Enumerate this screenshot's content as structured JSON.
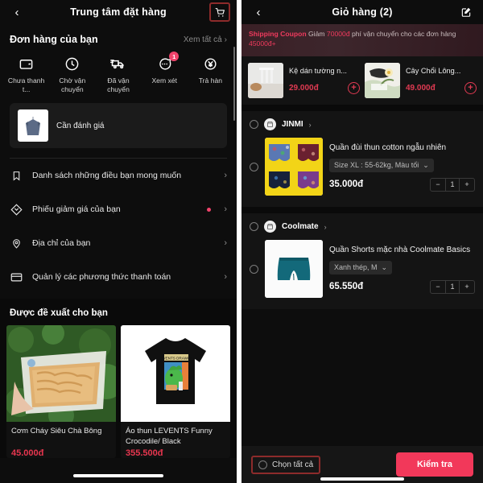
{
  "left_panel": {
    "header": {
      "back_icon": "chevron-left-icon",
      "title": "Trung tâm đặt hàng",
      "cart_icon": "cart-icon"
    },
    "orders_section": {
      "title": "Đơn hàng của bạn",
      "see_all": "Xem tất cả",
      "see_all_chevron": "›"
    },
    "status_items": [
      {
        "icon": "wallet-icon",
        "label": "Chưa thanh t...",
        "badge": ""
      },
      {
        "icon": "clock-icon",
        "label": "Chờ vận chuyển",
        "badge": ""
      },
      {
        "icon": "truck-icon",
        "label": "Đã vận chuyển",
        "badge": ""
      },
      {
        "icon": "chat-icon",
        "label": "Xem xét",
        "badge": "1"
      },
      {
        "icon": "refund-yen-icon",
        "label": "Trả hàn",
        "badge": ""
      }
    ],
    "review_card": {
      "thumb_icon": "shirt-hanger-image",
      "label": "Cần đánh giá"
    },
    "menu_items": [
      {
        "icon": "bookmark-icon",
        "label": "Danh sách những điều bạn mong muốn",
        "dot": false,
        "chevron": "›"
      },
      {
        "icon": "coupon-icon",
        "label": "Phiếu giảm giá của bạn",
        "dot": true,
        "chevron": "›"
      },
      {
        "icon": "location-pin-icon",
        "label": "Địa chỉ của bạn",
        "dot": false,
        "chevron": "›"
      },
      {
        "icon": "credit-card-icon",
        "label": "Quản lý các phương thức thanh toán",
        "dot": false,
        "chevron": "›"
      }
    ],
    "recommend": {
      "title": "Được đề xuất cho bạn",
      "products": [
        {
          "name": "Cơm Cháy Siêu Chà Bông",
          "price": "45.000đ",
          "image": "rice-crisp-snack-photo"
        },
        {
          "name": "Áo thun LEVENTS Funny Crocodile/ Black",
          "price": "355.500đ",
          "image": "black-tshirt-photo"
        }
      ]
    }
  },
  "right_panel": {
    "header": {
      "back_icon": "chevron-left-icon",
      "title": "Giỏ hàng (2)",
      "edit_icon": "edit-square-icon"
    },
    "coupon": {
      "tag": "Shipping Coupon",
      "text_before": "Giảm ",
      "amount1": "70000đ",
      "text_mid": " phí vận chuyển cho các đơn hàng ",
      "amount2": "45000đ+"
    },
    "promos": [
      {
        "name": "Kệ dán tường n...",
        "price": "29.000đ",
        "add_icon": "plus-circle-icon",
        "image": "wall-shelf-photo"
      },
      {
        "name": "Cây Chổi Lông...",
        "price": "49.000đ",
        "add_icon": "plus-circle-icon",
        "image": "feather-duster-photo"
      }
    ],
    "shops": [
      {
        "select_icon": "radio-unchecked-icon",
        "shop_icon": "store-icon",
        "name": "JINMI",
        "chevron": "›",
        "item": {
          "select_icon": "radio-unchecked-icon",
          "name": "Quần đùi thun cotton ngẫu nhiên",
          "variant": "Size XL : 55-62kg, Màu tối",
          "variant_chevron": "⌄",
          "price": "35.000đ",
          "qty": "1",
          "minus": "−",
          "plus": "+",
          "image": "boxer-shorts-grid-photo"
        }
      },
      {
        "select_icon": "radio-unchecked-icon",
        "shop_icon": "store-icon",
        "name": "Coolmate",
        "chevron": "›",
        "item": {
          "select_icon": "radio-unchecked-icon",
          "name": "Quần Shorts mặc nhà Coolmate Basics",
          "variant": "Xanh thép, M",
          "variant_chevron": "⌄",
          "price": "65.550đ",
          "qty": "1",
          "minus": "−",
          "plus": "+",
          "image": "teal-shorts-photo"
        }
      }
    ],
    "bottom_bar": {
      "select_all_icon": "radio-unchecked-icon",
      "select_all_label": "Chọn tất cả",
      "checkout_label": "Kiểm tra"
    }
  },
  "colors": {
    "accent_pink": "#f2385a",
    "price_red": "#e03a52",
    "badge_pink": "#f0436b",
    "highlight_border": "#8d2b2b",
    "background": "#0d0d0d"
  }
}
